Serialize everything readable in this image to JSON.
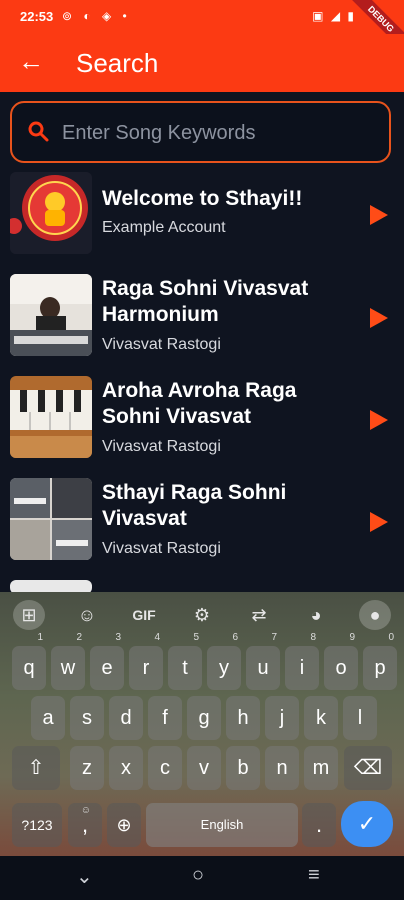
{
  "status_bar": {
    "time": "22:53",
    "debug": "DEBUG"
  },
  "app_bar": {
    "title": "Search"
  },
  "search": {
    "placeholder": "Enter Song Keywords"
  },
  "results": [
    {
      "title": "Welcome to Sthayi!!",
      "subtitle": "Example Account"
    },
    {
      "title": "Raga Sohni Vivasvat Harmonium",
      "subtitle": "Vivasvat Rastogi"
    },
    {
      "title": "Aroha Avroha Raga Sohni Vivasvat",
      "subtitle": "Vivasvat Rastogi"
    },
    {
      "title": "Sthayi Raga Sohni Vivasvat",
      "subtitle": "Vivasvat Rastogi"
    }
  ],
  "keyboard": {
    "toolbar": {
      "gif": "GIF"
    },
    "row1": [
      "q",
      "w",
      "e",
      "r",
      "t",
      "y",
      "u",
      "i",
      "o",
      "p"
    ],
    "row1_hints": [
      "1",
      "2",
      "3",
      "4",
      "5",
      "6",
      "7",
      "8",
      "9",
      "0"
    ],
    "row2": [
      "a",
      "s",
      "d",
      "f",
      "g",
      "h",
      "j",
      "k",
      "l"
    ],
    "row3": [
      "z",
      "x",
      "c",
      "v",
      "b",
      "n",
      "m"
    ],
    "symbols_label": "?123",
    "comma": ",",
    "space_label": "English",
    "period": "."
  },
  "colors": {
    "accent": "#fc3a13",
    "background": "#0f1420",
    "enter": "#3c8ff3"
  }
}
